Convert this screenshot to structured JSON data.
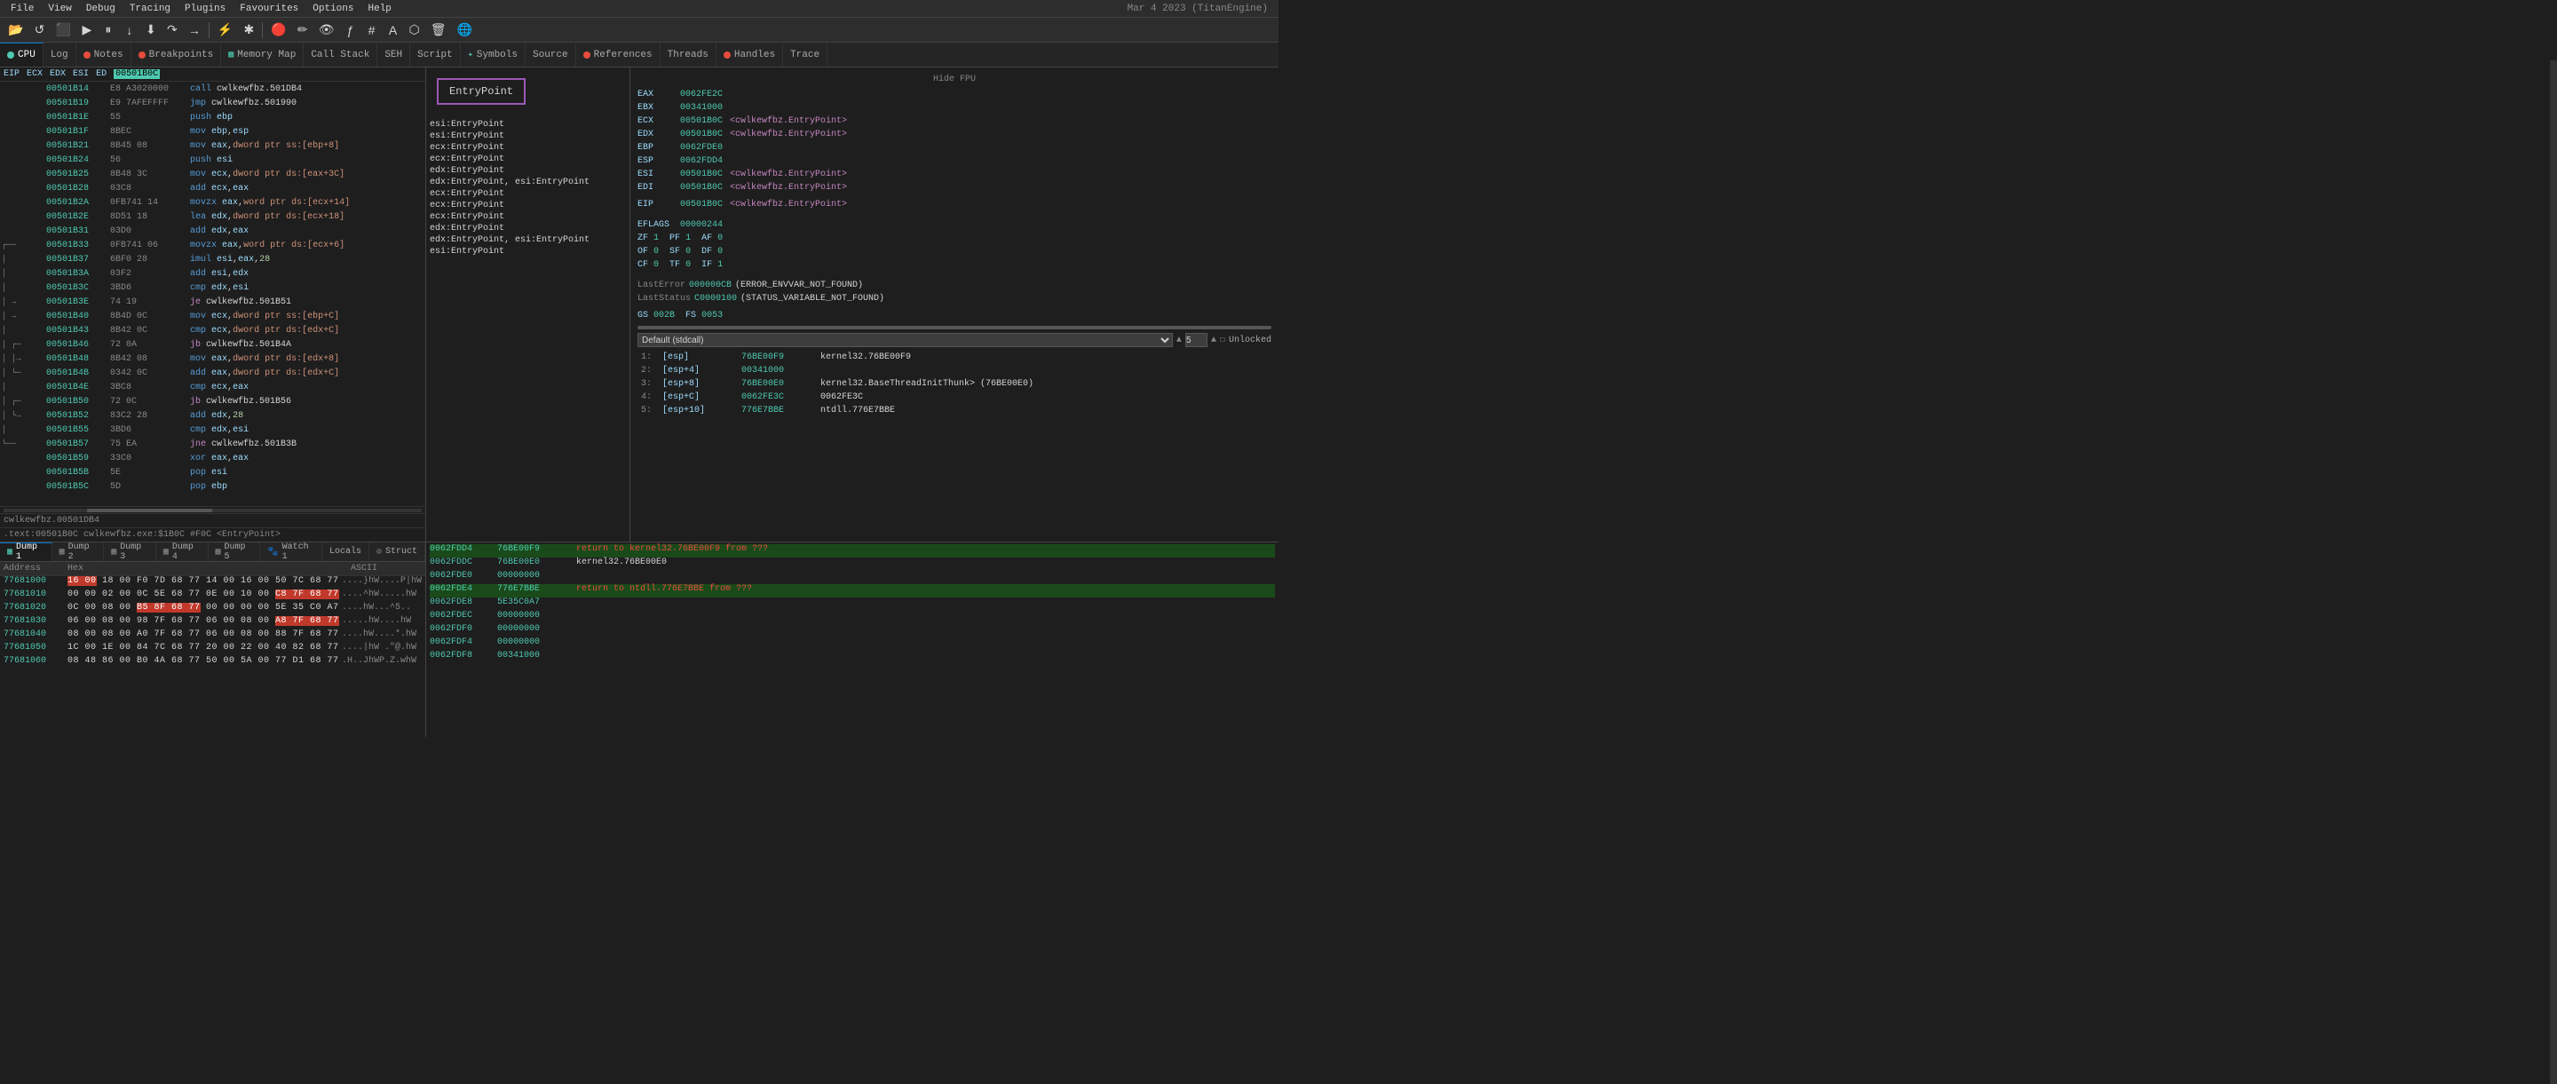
{
  "app": {
    "title": "Mar 4 2023 (TitanEngine)",
    "menu_items": [
      "File",
      "View",
      "Debug",
      "Tracing",
      "Plugins",
      "Favourites",
      "Options",
      "Help"
    ]
  },
  "toolbar": {
    "buttons": [
      "↺",
      "⬛",
      "▶",
      "⏸",
      "⏩",
      "↓",
      "⬇",
      "↷",
      "→",
      "≡",
      "⊕",
      "✎",
      "⌛",
      "ƒ",
      "#",
      "A",
      "⬡",
      "🗑",
      "🌐"
    ]
  },
  "tabs": [
    {
      "id": "cpu",
      "label": "CPU",
      "color": "#4ec9b0",
      "active": true
    },
    {
      "id": "log",
      "label": "Log",
      "color": "#888"
    },
    {
      "id": "notes",
      "label": "Notes",
      "color": "#e74c3c"
    },
    {
      "id": "breakpoints",
      "label": "Breakpoints",
      "color": "#e74c3c"
    },
    {
      "id": "memmap",
      "label": "Memory Map",
      "color": "#888"
    },
    {
      "id": "callstack",
      "label": "Call Stack",
      "color": "#888"
    },
    {
      "id": "seh",
      "label": "SEH",
      "color": "#888"
    },
    {
      "id": "script",
      "label": "Script",
      "color": "#888"
    },
    {
      "id": "symbols",
      "label": "Symbols",
      "color": "#888"
    },
    {
      "id": "source",
      "label": "Source",
      "color": "#888"
    },
    {
      "id": "references",
      "label": "References",
      "color": "#e74c3c"
    },
    {
      "id": "threads",
      "label": "Threads",
      "color": "#888"
    },
    {
      "id": "handles",
      "label": "Handles",
      "color": "#e74c3c"
    },
    {
      "id": "trace",
      "label": "Trace",
      "color": "#888"
    }
  ],
  "registers_header": {
    "eip_label": "EIP",
    "ecx_label": "ECX",
    "edx_label": "EDX",
    "esi_label": "ESI",
    "ed_label": "ED",
    "value": "00501B0C"
  },
  "disasm": {
    "rows": [
      {
        "addr": "00501B14",
        "bytes": "E8 A3020000",
        "instr": "call cwlkewfbz.501DB4",
        "arrow": ""
      },
      {
        "addr": "00501B19",
        "bytes": "E9 7AFEFFFF",
        "instr": "jmp cwlkewfbz.501990",
        "arrow": ""
      },
      {
        "addr": "00501B1E",
        "bytes": "55",
        "instr": "push ebp",
        "arrow": ""
      },
      {
        "addr": "00501B1F",
        "bytes": "8BEC",
        "instr": "mov ebp,esp",
        "arrow": ""
      },
      {
        "addr": "00501B21",
        "bytes": "8B45 08",
        "instr": "mov eax,dword ptr ss:[ebp+8]",
        "arrow": ""
      },
      {
        "addr": "00501B24",
        "bytes": "56",
        "instr": "push esi",
        "arrow": ""
      },
      {
        "addr": "00501B25",
        "bytes": "8B48 3C",
        "instr": "mov ecx,dword ptr ds:[eax+3C]",
        "arrow": ""
      },
      {
        "addr": "00501B28",
        "bytes": "03C8",
        "instr": "add ecx,eax",
        "arrow": ""
      },
      {
        "addr": "00501B2A",
        "bytes": "0FB741 14",
        "instr": "movzx eax,word ptr ds:[ecx+14]",
        "arrow": ""
      },
      {
        "addr": "00501B2E",
        "bytes": "8D51 18",
        "instr": "lea edx,dword ptr ds:[ecx+18]",
        "arrow": ""
      },
      {
        "addr": "00501B31",
        "bytes": "03D0",
        "instr": "add edx,eax",
        "arrow": ""
      },
      {
        "addr": "00501B33",
        "bytes": "0FB741 06",
        "instr": "movzx eax,word ptr ds:[ecx+6]",
        "arrow": ""
      },
      {
        "addr": "00501B37",
        "bytes": "6BF0 28",
        "instr": "imul esi,eax,28",
        "arrow": ""
      },
      {
        "addr": "00501B3A",
        "bytes": "03F2",
        "instr": "add esi,edx",
        "arrow": ""
      },
      {
        "addr": "00501B3C",
        "bytes": "3BD6",
        "instr": "cmp edx,esi",
        "arrow": ""
      },
      {
        "addr": "00501B3E",
        "bytes": "74 19",
        "instr": "je cwlkewfbz.501B51",
        "arrow": "→"
      },
      {
        "addr": "00501B40",
        "bytes": "8B4D 0C",
        "instr": "mov ecx,dword ptr ss:[ebp+C]",
        "arrow": "→"
      },
      {
        "addr": "00501B43",
        "bytes": "8B42 0C",
        "instr": "cmp ecx,dword ptr ds:[edx+C]",
        "arrow": ""
      },
      {
        "addr": "00501B46",
        "bytes": "72 0A",
        "instr": "jb cwlkewfbz.501B4A",
        "arrow": ""
      },
      {
        "addr": "00501B48",
        "bytes": "8B42 08",
        "instr": "mov eax,dword ptr ds:[edx+8]",
        "arrow": "→"
      },
      {
        "addr": "00501B4B",
        "bytes": "0342 0C",
        "instr": "add eax,dword ptr ds:[edx+C]",
        "arrow": ""
      },
      {
        "addr": "00501B4E",
        "bytes": "3BC8",
        "instr": "cmp ecx,eax",
        "arrow": ""
      },
      {
        "addr": "00501B50",
        "bytes": "72 0C",
        "instr": "jb cwlkewfbz.501B56",
        "arrow": ""
      },
      {
        "addr": "00501B52",
        "bytes": "83C2 28",
        "instr": "add edx,28",
        "arrow": "→"
      },
      {
        "addr": "00501B55",
        "bytes": "3BD6",
        "instr": "cmp edx,esi",
        "arrow": ""
      },
      {
        "addr": "00501B57",
        "bytes": "75 EA",
        "instr": "jne cwlkewfbz.501B3B",
        "arrow": ""
      },
      {
        "addr": "00501B59",
        "bytes": "33C0",
        "instr": "xor eax,eax",
        "arrow": ""
      },
      {
        "addr": "00501B5B",
        "bytes": "5E",
        "instr": "pop esi",
        "arrow": ""
      },
      {
        "addr": "00501B5C",
        "bytes": "5D",
        "instr": "pop ebp",
        "arrow": ""
      }
    ],
    "current_addr": "00501B0C",
    "status_line": "cwlkewfbz.00501DB4",
    "info_line": ".text:00501B0C cwlkewfbz.exe:$1B0C #F0C <EntryPoint>"
  },
  "trace_panel": {
    "entry_box": "EntryPoint",
    "rows": [
      "esi:EntryPoint",
      "esi:EntryPoint",
      "ecx:EntryPoint",
      "ecx:EntryPoint",
      "edx:EntryPoint",
      "edx:EntryPoint, esi:EntryPoint",
      "ecx:EntryPoint",
      "ecx:EntryPoint",
      "ecx:EntryPoint",
      "edx:EntryPoint",
      "edx:EntryPoint, esi:EntryPoint",
      "esi:EntryPoint"
    ]
  },
  "registers": {
    "hide_fpu_label": "Hide FPU",
    "regs": [
      {
        "name": "EAX",
        "value": "0062FE2C",
        "comment": ""
      },
      {
        "name": "EBX",
        "value": "00341000",
        "comment": ""
      },
      {
        "name": "ECX",
        "value": "00501B0C",
        "comment": "<cwlkewfbz.EntryPoint>"
      },
      {
        "name": "EDX",
        "value": "00501B0C",
        "comment": "<cwlkewfbz.EntryPoint>"
      },
      {
        "name": "EBP",
        "value": "0062FDE0",
        "comment": ""
      },
      {
        "name": "ESP",
        "value": "0062FDD4",
        "comment": ""
      },
      {
        "name": "ESI",
        "value": "00501B0C",
        "comment": "<cwlkewfbz.EntryPoint>"
      },
      {
        "name": "EDI",
        "value": "00501B0C",
        "comment": "<cwlkewfbz.EntryPoint>"
      },
      {
        "name": "EIP",
        "value": "00501B0C",
        "comment": "<cwlkewfbz.EntryPoint>"
      }
    ],
    "eflags_val": "00000244",
    "flags": [
      {
        "name": "ZF",
        "val": "1"
      },
      {
        "name": "PF",
        "val": "1"
      },
      {
        "name": "AF",
        "val": "0"
      },
      {
        "name": "OF",
        "val": "0"
      },
      {
        "name": "SF",
        "val": "0"
      },
      {
        "name": "DF",
        "val": "0"
      },
      {
        "name": "CF",
        "val": "0"
      },
      {
        "name": "TF",
        "val": "0"
      },
      {
        "name": "IF",
        "val": "1"
      }
    ],
    "last_error": "000000CB",
    "last_error_name": "(ERROR_ENVVAR_NOT_FOUND)",
    "last_status": "C0000100",
    "last_status_name": "(STATUS_VARIABLE_NOT_FOUND)",
    "gs": "002B",
    "fs": "0053",
    "call_convention": "Default (stdcall)",
    "stack_depth": "5"
  },
  "stack_entries": [
    {
      "idx": "1:",
      "addr": "[esp]",
      "val": "76BE00F9",
      "comment": "kernel32.76BE00F9"
    },
    {
      "idx": "2:",
      "addr": "[esp+4]",
      "val": "00341000",
      "comment": ""
    },
    {
      "idx": "3:",
      "addr": "[esp+8]",
      "val": "76BE00E0",
      "comment": "kernel32.BaseThreadInitThunk> (76BE00E0)"
    },
    {
      "idx": "4:",
      "addr": "[esp+C]",
      "val": "0062FE3C",
      "comment": "0062FE3C"
    },
    {
      "idx": "5:",
      "addr": "[esp+10]",
      "val": "776E7BBE",
      "comment": "ntdll.776E7BBE"
    }
  ],
  "dump_tabs": [
    {
      "id": "dump1",
      "label": "Dump 1",
      "active": true
    },
    {
      "id": "dump2",
      "label": "Dump 2"
    },
    {
      "id": "dump3",
      "label": "Dump 3"
    },
    {
      "id": "dump4",
      "label": "Dump 4"
    },
    {
      "id": "dump5",
      "label": "Dump 5"
    },
    {
      "id": "watch1",
      "label": "Watch 1"
    },
    {
      "id": "locals",
      "label": "Locals"
    },
    {
      "id": "struct",
      "label": "Struct"
    }
  ],
  "dump_rows": [
    {
      "addr": "77681000",
      "hex": "16 00 18 00 F0 7D 68 77 14 00 16 00 50 7C 68 77",
      "ascii": "....}hW....P|hW"
    },
    {
      "addr": "77681010",
      "hex": "00 00 02 00 0C 5E 68 77 0E 00 10 00 C8 7F 68 77",
      "ascii": "....^hW.....hW"
    },
    {
      "addr": "77681020",
      "hex": "0C 00 08 00 B5 8F 68 77 00 00 00 00 5E 35 C0 A7",
      "ascii": "....hW...^5."
    },
    {
      "addr": "77681030",
      "hex": "06 00 08 00 98 7F 68 77 06 00 08 00 A8 7F 68 77",
      "ascii": ".....hW....hW"
    },
    {
      "addr": "77681040",
      "hex": "08 00 08 00 A0 7F 68 77 06 00 08 00 88 7F 68 77",
      "ascii": "....hW...*.hW"
    },
    {
      "addr": "77681050",
      "hex": "1C 00 1E 00 84 7C 68 77 20 00 22 00 40 82 68 77",
      "ascii": ".....|hW .\"@.hW"
    },
    {
      "addr": "77681060",
      "hex": "08 48 86 00 B0 4A 68 77 50 00 5A 00 77 D1 68 77",
      "ascii": ".H..JhWP.Z.whW"
    }
  ],
  "stack_right": {
    "rows": [
      {
        "addr": "0062FDD4",
        "val": "76BE00F9",
        "comment": "return to kernel32.76BE00F9 from ???",
        "highlight": true
      },
      {
        "addr": "0062FDDC",
        "val": "76BE00E0",
        "comment": "kernel32.76BE00E0"
      },
      {
        "addr": "0062FDE0",
        "val": "00000000",
        "comment": ""
      },
      {
        "addr": "0062FDE4",
        "val": "776E7BBE",
        "comment": "return to ntdll.776E7BBE from ???",
        "highlight": true
      },
      {
        "addr": "0062FDE8",
        "val": "5E35C0A7",
        "comment": ""
      },
      {
        "addr": "0062FDEC",
        "val": "00000000",
        "comment": ""
      },
      {
        "addr": "0062FDF0",
        "val": "00000000",
        "comment": ""
      },
      {
        "addr": "0062FDF4",
        "val": "00000000",
        "comment": ""
      },
      {
        "addr": "0062FDF8",
        "val": "00341000",
        "comment": ""
      }
    ]
  }
}
